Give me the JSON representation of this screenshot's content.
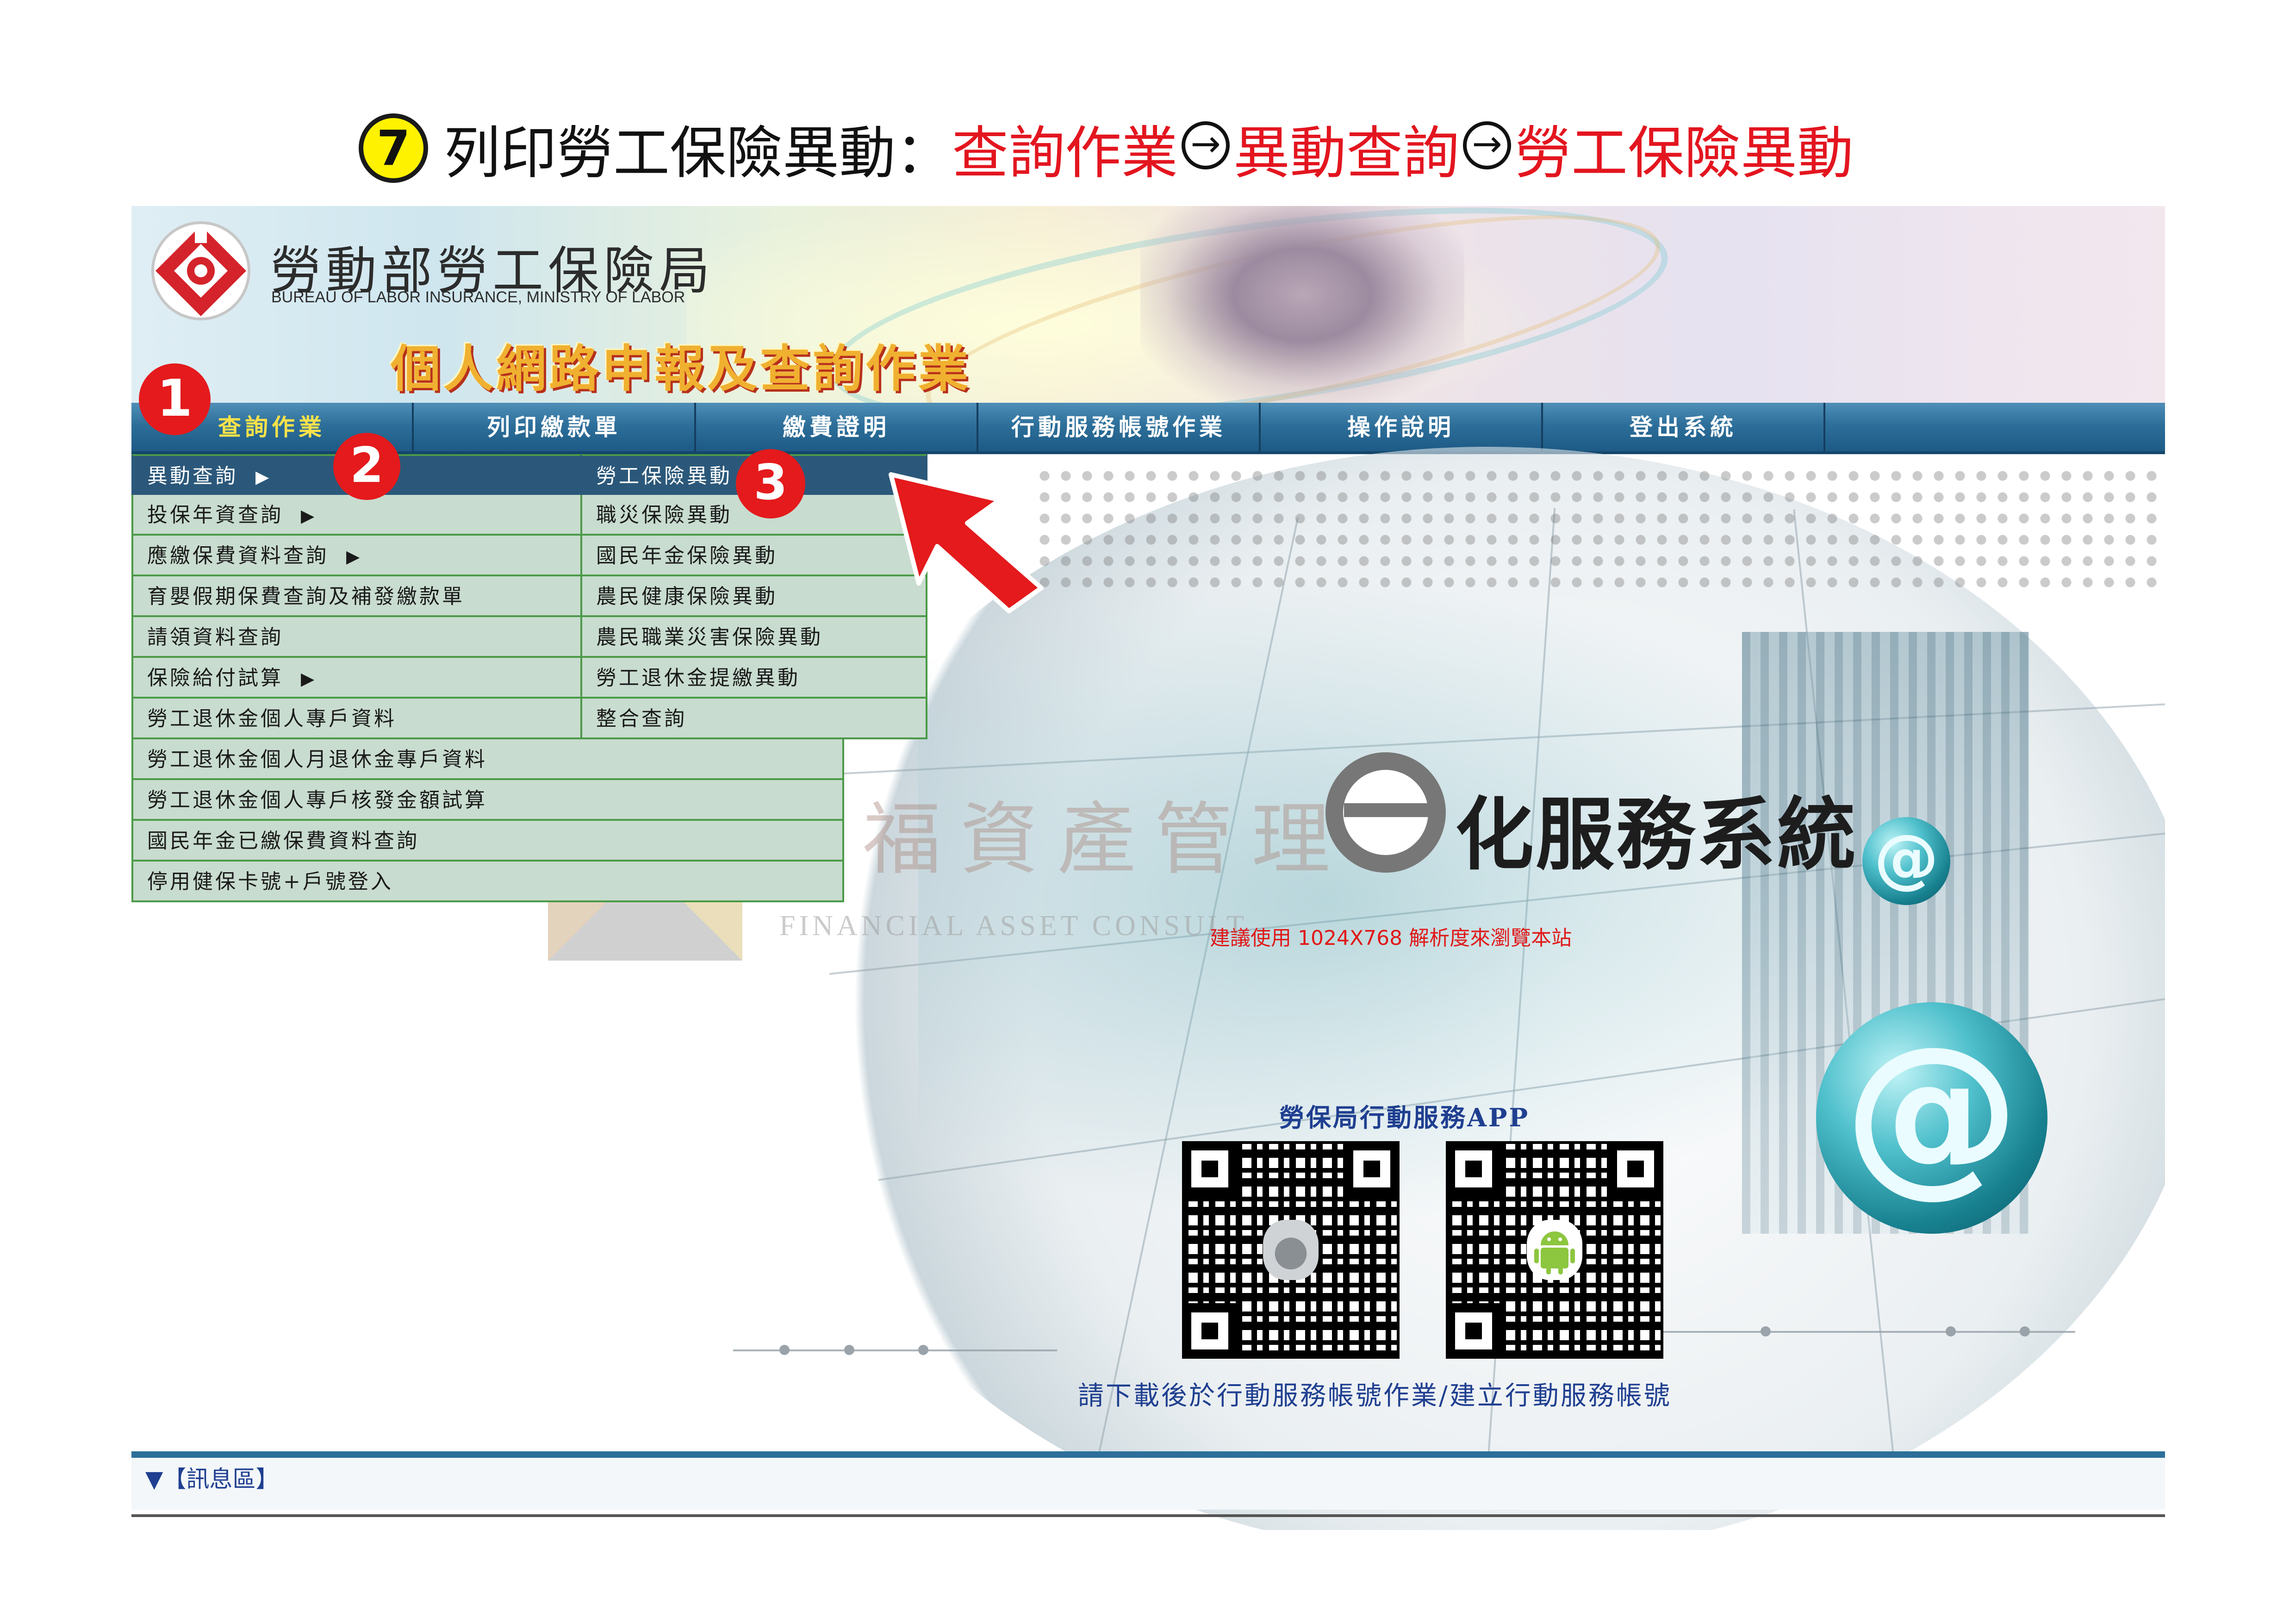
{
  "header": {
    "step_number": "7",
    "title_plain": "列印勞工保險異動：",
    "path": [
      "查詢作業",
      "異動查詢",
      "勞工保險異動"
    ],
    "path_separator_icon": "circled-right-arrow-icon"
  },
  "banner": {
    "agency_name": "勞動部勞工保險局",
    "agency_name_en": "BUREAU OF LABOR INSURANCE, MINISTRY OF LABOR",
    "service_title": "個人網路申報及查詢作業"
  },
  "nav": {
    "items": [
      "查詢作業",
      "列印繳款單",
      "繳費證明",
      "行動服務帳號作業",
      "操作說明",
      "登出系統"
    ],
    "active_index": 0
  },
  "menu_primary": {
    "items": [
      {
        "label": "異動查詢",
        "has_submenu": true
      },
      {
        "label": "投保年資查詢",
        "has_submenu": true
      },
      {
        "label": "應繳保費資料查詢",
        "has_submenu": true
      },
      {
        "label": "育嬰假期保費查詢及補發繳款單",
        "has_submenu": false
      },
      {
        "label": "請領資料查詢",
        "has_submenu": false
      },
      {
        "label": "保險給付試算",
        "has_submenu": true
      },
      {
        "label": "勞工退休金個人專戶資料",
        "has_submenu": false
      },
      {
        "label": "勞工退休金個人月退休金專戶資料",
        "has_submenu": false
      },
      {
        "label": "勞工退休金個人專戶核發金額試算",
        "has_submenu": false
      },
      {
        "label": "國民年金已繳保費資料查詢",
        "has_submenu": false
      },
      {
        "label": "停用健保卡號+戶號登入",
        "has_submenu": false
      }
    ],
    "submenu_arrow": "▶"
  },
  "menu_secondary": {
    "items": [
      "勞工保險異動",
      "職災保險異動",
      "國民年金保險異動",
      "農民健康保險異動",
      "農民職業災害保險異動",
      "勞工退休金提繳異動",
      "整合查詢"
    ]
  },
  "main": {
    "watermark_cn": "寶福資產管理",
    "watermark_en": "FINANCIAL ASSET CONSULT",
    "eservice_title": "化服務系統",
    "resolution_note": "建議使用 1024X768 解析度來瀏覽本站",
    "app_title": "勞保局行動服務APP",
    "download_note": "請下載後於行動服務帳號作業/建立行動服務帳號",
    "qr_codes": [
      {
        "platform": "ios",
        "center_icon": "apple-icon"
      },
      {
        "platform": "android",
        "center_icon": "android-icon"
      }
    ],
    "at_icon": "@"
  },
  "message_area": {
    "toggle_icon": "▼",
    "label": "【訊息區】"
  },
  "annotations": {
    "steps": [
      "1",
      "2",
      "3"
    ],
    "pointer_color": "#e41a1c"
  },
  "colors": {
    "nav_bar": "#2d6f9a",
    "menu_bg": "#c8dccf",
    "menu_border": "#4c9a48",
    "menu_selected": "#2b587a",
    "highlight_red": "#e3151f",
    "nav_active_text": "#ffe24a"
  }
}
